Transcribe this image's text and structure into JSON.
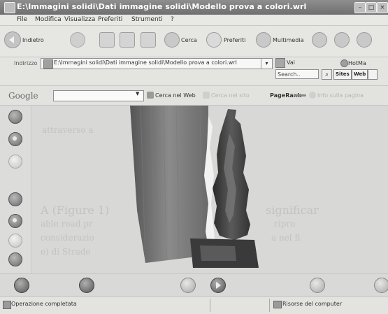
{
  "window": {
    "title": "E:\\Immagini solidi\\Dati immagine solidi\\Modello prova a colori.wrl",
    "controls": [
      "minimize",
      "maximize",
      "close"
    ]
  },
  "menu": [
    "File",
    "Modifica",
    "Visualizza",
    "Preferiti",
    "Strumenti",
    "?"
  ],
  "toolbar": {
    "back_label": "Indietro",
    "search_label": "Cerca",
    "favorites_label": "Preferiti",
    "multimedia_label": "Multimedia"
  },
  "address": {
    "label": "Indirizzo",
    "value": "E:\\Immagini solidi\\Dati immagine solidi\\Modello prova a colori.wrl",
    "go_label": "Vai",
    "hotmail_label": "HotMa",
    "search_field": "Search..",
    "btn1": "Sites",
    "btn2": "Web"
  },
  "google": {
    "logo": "Google",
    "search_web": "Cerca nel Web",
    "search_site": "Cerca nel sito",
    "pagerank": "PageRank",
    "info": "Info sulla pagina"
  },
  "ghost_text": {
    "line1": "attraverso a",
    "line2": "A (Figure 1)",
    "line3": "able road pr",
    "line4": "considerazio",
    "line5": "e) di Strade",
    "line6": "significar",
    "line7": "ripro",
    "line8": "a nel fi"
  },
  "status": {
    "message": "Operazione completata",
    "zone": "Risorse del computer"
  }
}
